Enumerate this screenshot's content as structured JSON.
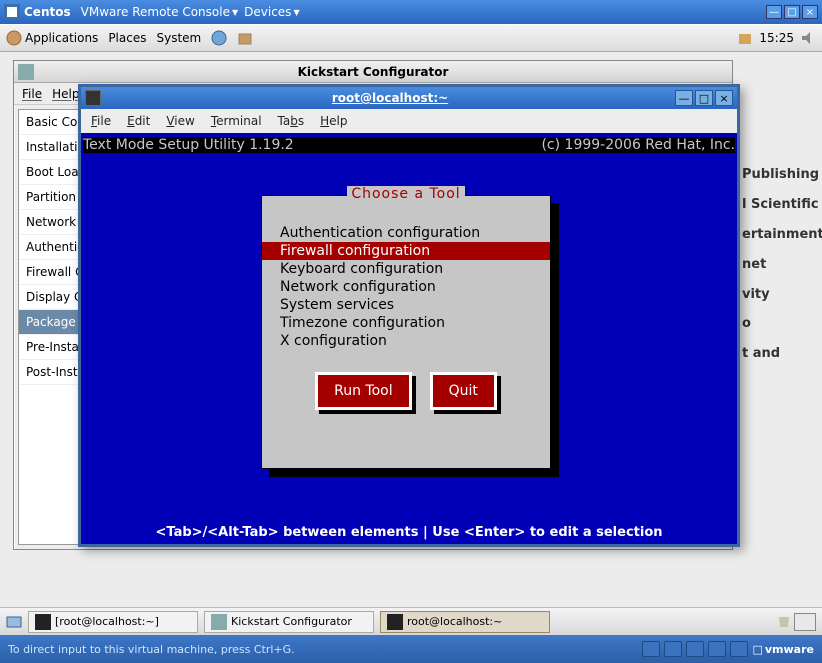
{
  "vmware": {
    "title": "Centos",
    "menus": [
      "VMware Remote Console",
      "Devices"
    ]
  },
  "gnome": {
    "menus": [
      "Applications",
      "Places",
      "System"
    ],
    "clock": "15:25"
  },
  "kickstart": {
    "title": "Kickstart Configurator",
    "menus": [
      "File",
      "Help"
    ],
    "items": [
      "Basic Configuration",
      "Installation Method",
      "Boot Loader Options",
      "Partition Information",
      "Network Configuration",
      "Authentication",
      "Firewall Configuration",
      "Display Configuration",
      "Package Selection",
      "Pre-Installation Script",
      "Post-Installation Script"
    ],
    "selected": 8
  },
  "rightPartial": [
    "Publishing",
    "l Scientific",
    "ertainment",
    "net",
    "vity",
    "o",
    "t and"
  ],
  "terminal": {
    "title": "root@localhost:~",
    "menus": [
      "File",
      "Edit",
      "View",
      "Terminal",
      "Tabs",
      "Help"
    ],
    "util_left": "Text Mode Setup Utility 1.19.2",
    "util_right": "(c) 1999-2006 Red Hat, Inc.",
    "panel_title": "Choose a Tool",
    "tools": [
      "Authentication configuration",
      "Firewall configuration",
      "Keyboard configuration",
      "Network configuration",
      "System services",
      "Timezone configuration",
      "X configuration"
    ],
    "selected": 1,
    "run": "Run Tool",
    "quit": "Quit",
    "hint": "<Tab>/<Alt-Tab> between elements   |   Use <Enter> to edit a selection"
  },
  "taskbar": [
    "[root@localhost:~]",
    "Kickstart Configurator",
    "root@localhost:~"
  ],
  "status": {
    "msg": "To direct input to this virtual machine, press Ctrl+G.",
    "brand": "vmware"
  }
}
